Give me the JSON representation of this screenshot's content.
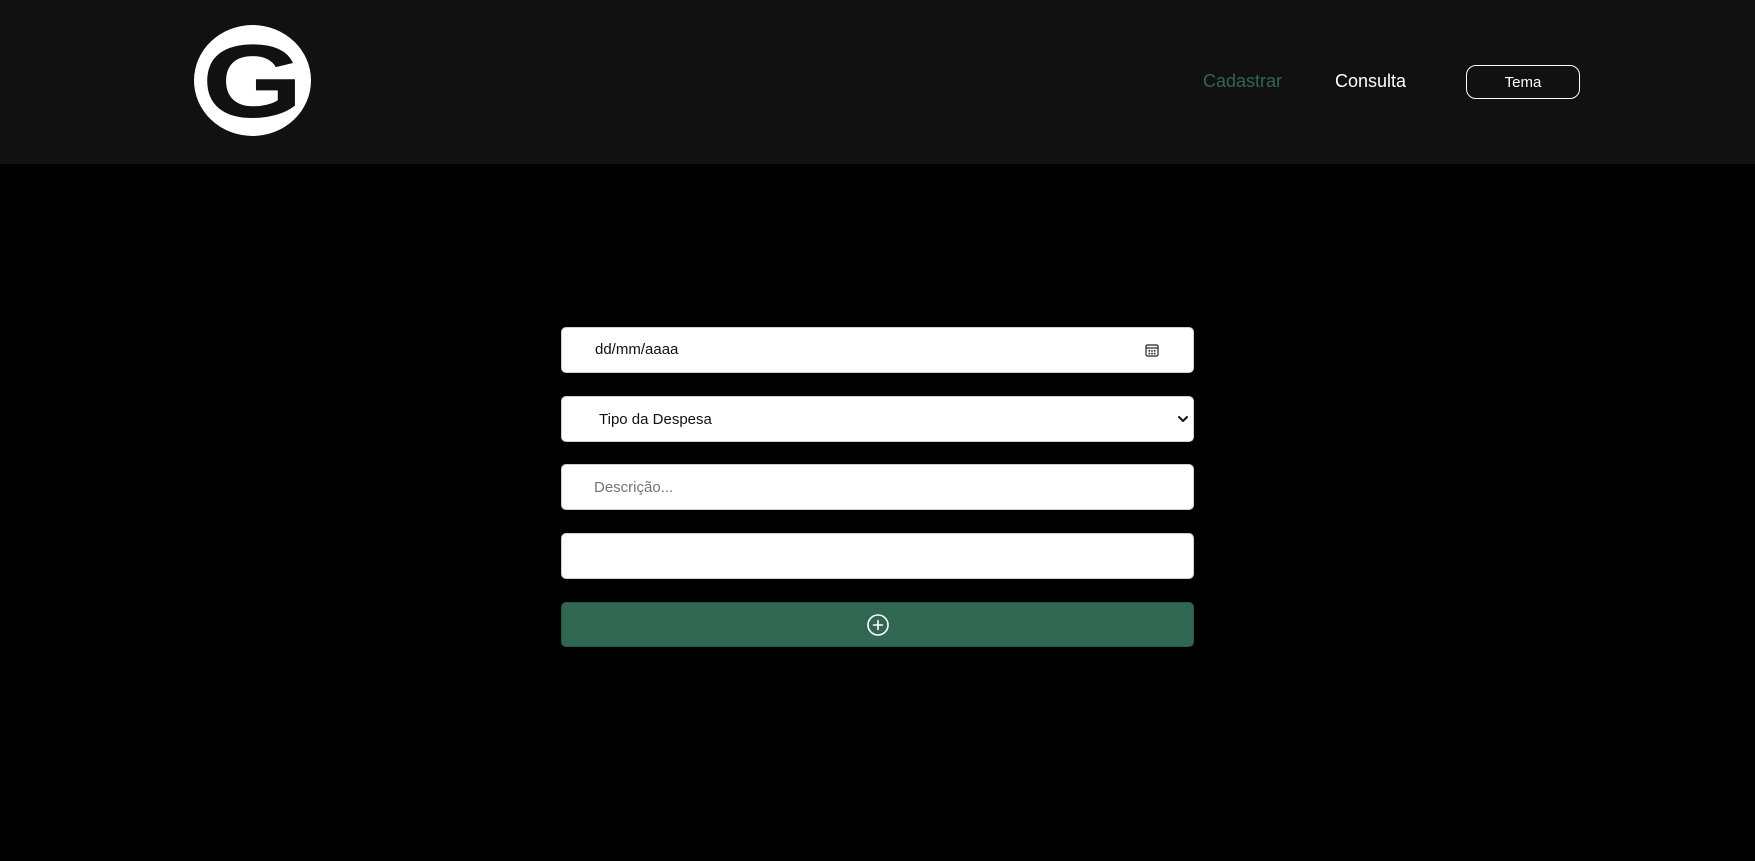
{
  "header": {
    "logo": {
      "letter": "G",
      "icon": "g-logo-icon"
    },
    "nav": {
      "cadastrar_label": "Cadastrar",
      "consulta_label": "Consulta"
    },
    "tema_label": "Tema"
  },
  "form": {
    "date_field": {
      "placeholder": "dd/mm/aaaa",
      "icon": "calendar-icon"
    },
    "expense_type_select": {
      "selected": "Tipo da Despesa",
      "icon": "chevron-down-icon"
    },
    "description_input": {
      "value": "",
      "placeholder": "Descrição..."
    },
    "value_input": {
      "value": "",
      "placeholder": ""
    },
    "add_button": {
      "icon": "plus-circle-icon"
    }
  },
  "colors": {
    "header_bg": "#111111",
    "page_bg": "#000000",
    "accent": "#306652",
    "text_light": "#ffffff"
  }
}
